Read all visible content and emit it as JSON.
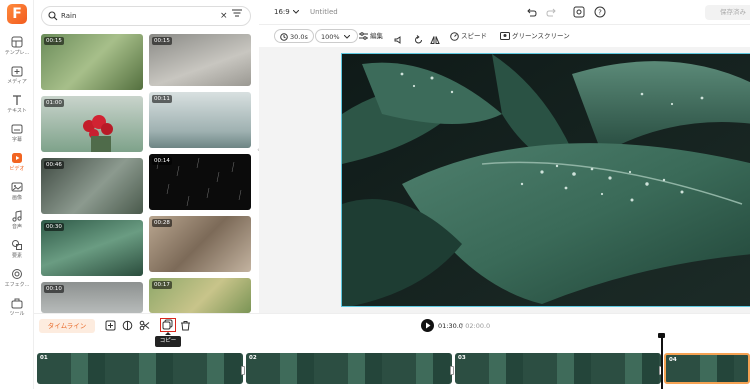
{
  "app": {
    "logo_letter": "F"
  },
  "sidebar": {
    "items": [
      {
        "label": "テンプレ...",
        "icon": "template-icon"
      },
      {
        "label": "メディア",
        "icon": "media-icon"
      },
      {
        "label": "テキスト",
        "icon": "text-icon"
      },
      {
        "label": "字幕",
        "icon": "subtitle-icon"
      },
      {
        "label": "ビデオ",
        "icon": "video-icon",
        "active": true
      },
      {
        "label": "画像",
        "icon": "image-icon"
      },
      {
        "label": "音声",
        "icon": "audio-icon"
      },
      {
        "label": "要素",
        "icon": "elements-icon"
      },
      {
        "label": "エフェク...",
        "icon": "effects-icon"
      },
      {
        "label": "ツール",
        "icon": "tools-icon"
      }
    ]
  },
  "search": {
    "value": "Rain",
    "clear_icon": "close-icon",
    "filter_icon": "filter-icon"
  },
  "media": {
    "items": [
      {
        "duration": "00:15"
      },
      {
        "duration": "00:15"
      },
      {
        "duration": "01:00"
      },
      {
        "duration": "00:11"
      },
      {
        "duration": "00:46"
      },
      {
        "duration": "00:14"
      },
      {
        "duration": "00:30"
      },
      {
        "duration": "00:28"
      },
      {
        "duration": "00:10"
      },
      {
        "duration": "00:17"
      }
    ]
  },
  "topbar": {
    "aspect": "16:9",
    "title": "Untitled",
    "save_label": "保存済み"
  },
  "toolbar": {
    "duration": "30.0s",
    "zoom": "100%",
    "edit": "編集",
    "speed": "スピード",
    "green_screen": "グリーンスクリーン"
  },
  "timeline": {
    "tab_label": "タイムライン",
    "current_time": "01:30.0",
    "total_time": "/ 02:00.0",
    "tooltip": "コピー",
    "clips": [
      {
        "num": "01"
      },
      {
        "num": "02"
      },
      {
        "num": "03"
      },
      {
        "num": "04"
      }
    ]
  },
  "colors": {
    "accent": "#f26522",
    "selection": "#5ec8e0",
    "highlight": "#d9261c"
  }
}
